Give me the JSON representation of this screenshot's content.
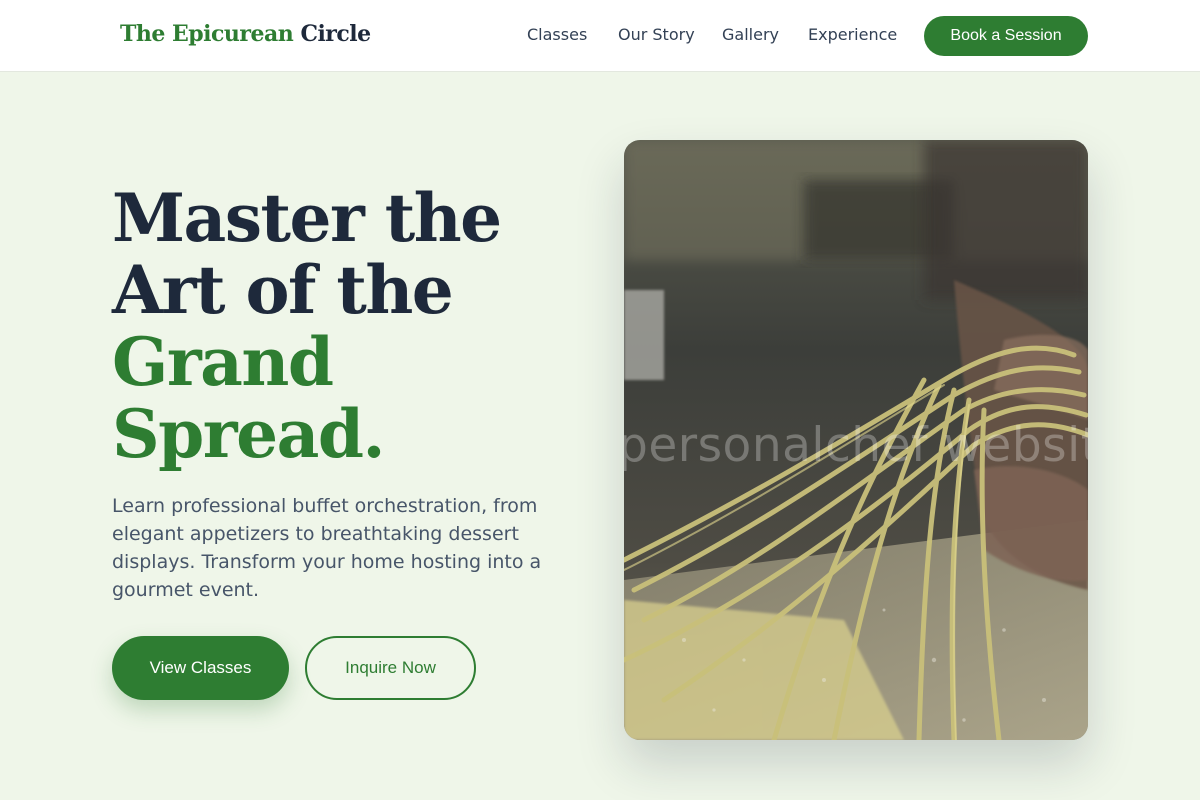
{
  "brand": {
    "name_part1": "The Epicurean",
    "name_part2": "Circle"
  },
  "nav": {
    "links": [
      {
        "label": "Classes"
      },
      {
        "label": "Our Story"
      },
      {
        "label": "Gallery"
      },
      {
        "label": "Experience"
      }
    ],
    "cta_label": "Book a Session"
  },
  "hero": {
    "headline_line1": "Master the",
    "headline_line2": "Art of the",
    "headline_line3": "Grand",
    "headline_line4": "Spread.",
    "subtext": "Learn professional buffet orchestration, from elegant appetizers to breathtaking dessert displays. Transform your home hosting into a gourmet event.",
    "primary_button": "View Classes",
    "secondary_button": "Inquire Now",
    "image_watermark": "personalchef website"
  },
  "colors": {
    "accent": "#2e7d32",
    "heading": "#1e293b",
    "body_text": "#475569",
    "background": "#eff6e9"
  },
  "icons": []
}
